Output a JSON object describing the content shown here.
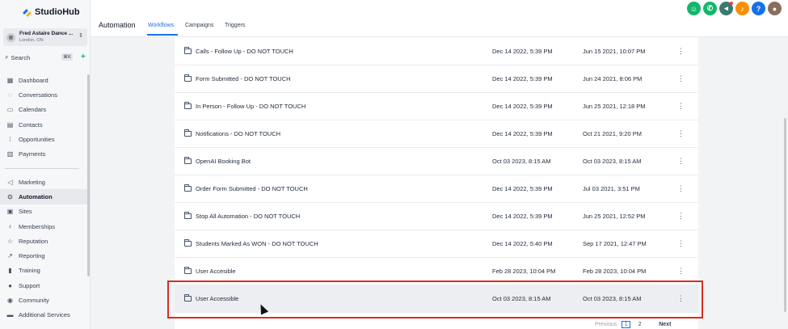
{
  "brand": {
    "name": "StudioHub"
  },
  "account": {
    "name": "Fred Astaire Dance ...",
    "location": "London, ON"
  },
  "search": {
    "label": "Search",
    "shortcut": "⌘K"
  },
  "sidebar": {
    "items": [
      {
        "label": "Dashboard",
        "icon": "dashboard-icon"
      },
      {
        "label": "Conversations",
        "icon": "chat-icon"
      },
      {
        "label": "Calendars",
        "icon": "calendar-icon"
      },
      {
        "label": "Contacts",
        "icon": "contacts-icon"
      },
      {
        "label": "Opportunities",
        "icon": "opportunities-icon"
      },
      {
        "label": "Payments",
        "icon": "payments-icon"
      }
    ],
    "items2": [
      {
        "label": "Marketing",
        "icon": "send-icon"
      },
      {
        "label": "Automation",
        "icon": "automation-icon",
        "active": true
      },
      {
        "label": "Sites",
        "icon": "sites-icon"
      },
      {
        "label": "Memberships",
        "icon": "membership-icon"
      },
      {
        "label": "Reputation",
        "icon": "star-icon"
      },
      {
        "label": "Reporting",
        "icon": "trend-icon"
      },
      {
        "label": "Training",
        "icon": "book-icon"
      },
      {
        "label": "Support",
        "icon": "support-icon"
      },
      {
        "label": "Community",
        "icon": "community-icon"
      },
      {
        "label": "Additional Services",
        "icon": "cart-icon"
      }
    ]
  },
  "header": {
    "title": "Automation",
    "tabs": [
      {
        "label": "Workflows",
        "active": true
      },
      {
        "label": "Campaigns"
      },
      {
        "label": "Triggers"
      }
    ],
    "icons": [
      {
        "name": "contact-icon",
        "color": "#12b76a"
      },
      {
        "name": "phone-icon",
        "color": "#12b76a"
      },
      {
        "name": "megaphone-icon",
        "color": "#3d7a6e"
      },
      {
        "name": "bell-icon",
        "color": "#f79009"
      },
      {
        "name": "help-icon",
        "color": "#1570ef"
      },
      {
        "name": "avatar",
        "color": "#8a6e5a"
      }
    ]
  },
  "rows": [
    {
      "name": "Calls - Follow Up - DO NOT TOUCH",
      "updated": "Dec 14 2022, 5:39 PM",
      "created": "Jun 15 2021, 10:07 PM"
    },
    {
      "name": "Form Submitted - DO NOT TOUCH",
      "updated": "Dec 14 2022, 5:39 PM",
      "created": "Jun 24 2021, 8:06 PM"
    },
    {
      "name": "In Person - Follow Up - DO NOT TOUCH",
      "updated": "Dec 14 2022, 5:39 PM",
      "created": "Jun 25 2021, 12:18 PM"
    },
    {
      "name": "Notifications - DO NOT TOUCH",
      "updated": "Dec 14 2022, 5:39 PM",
      "created": "Oct 21 2021, 9:20 PM"
    },
    {
      "name": "OpenAI Booking Bot",
      "updated": "Oct 03 2023, 8:15 AM",
      "created": "Oct 03 2023, 8:15 AM"
    },
    {
      "name": "Order Form Submitted - DO NOT TOUCH",
      "updated": "Dec 14 2022, 5:39 PM",
      "created": "Jul 03 2021, 3:51 PM"
    },
    {
      "name": "Stop All Automation - DO NOT TOUCH",
      "updated": "Dec 14 2022, 5:39 PM",
      "created": "Jun 25 2021, 12:52 PM"
    },
    {
      "name": "Students Marked As WON - DO NOT TOUCH",
      "updated": "Dec 14 2022, 5:40 PM",
      "created": "Sep 17 2021, 12:47 PM"
    },
    {
      "name": "User Accesible",
      "updated": "Feb 28 2023, 10:04 PM",
      "created": "Feb 28 2023, 10:04 PM"
    },
    {
      "name": "User Accessible",
      "updated": "Oct 03 2023, 8:15 AM",
      "created": "Oct 03 2023, 8:15 AM",
      "highlight": true
    }
  ],
  "pagination": {
    "prev": "Previous",
    "pages": [
      "1",
      "2"
    ],
    "current": "1",
    "next": "Next"
  }
}
